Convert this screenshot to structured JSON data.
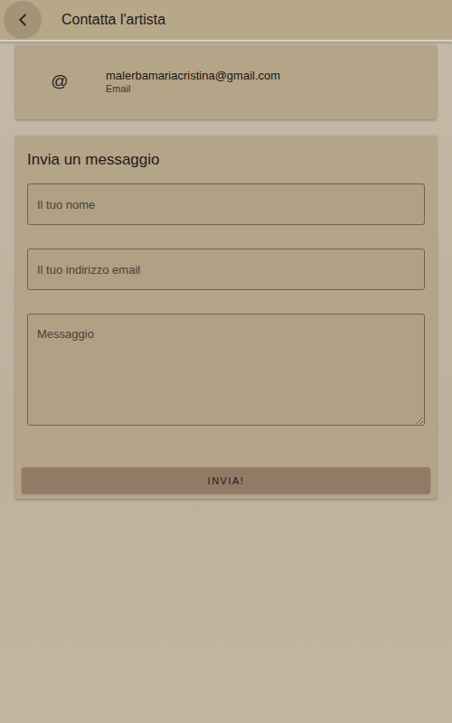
{
  "window": {
    "title": "Contatta l'artista"
  },
  "contact": {
    "icon": "@",
    "value": "malerbamariacristina@gmail.com",
    "label": "Email"
  },
  "form": {
    "title": "Invia un messaggio",
    "fields": [
      {
        "kind": "input",
        "placeholder": "Il tuo nome"
      },
      {
        "kind": "input",
        "placeholder": "Il tuo indirizzo email"
      },
      {
        "kind": "textarea",
        "placeholder": "Messaggio"
      }
    ],
    "button": "INVIA!"
  }
}
